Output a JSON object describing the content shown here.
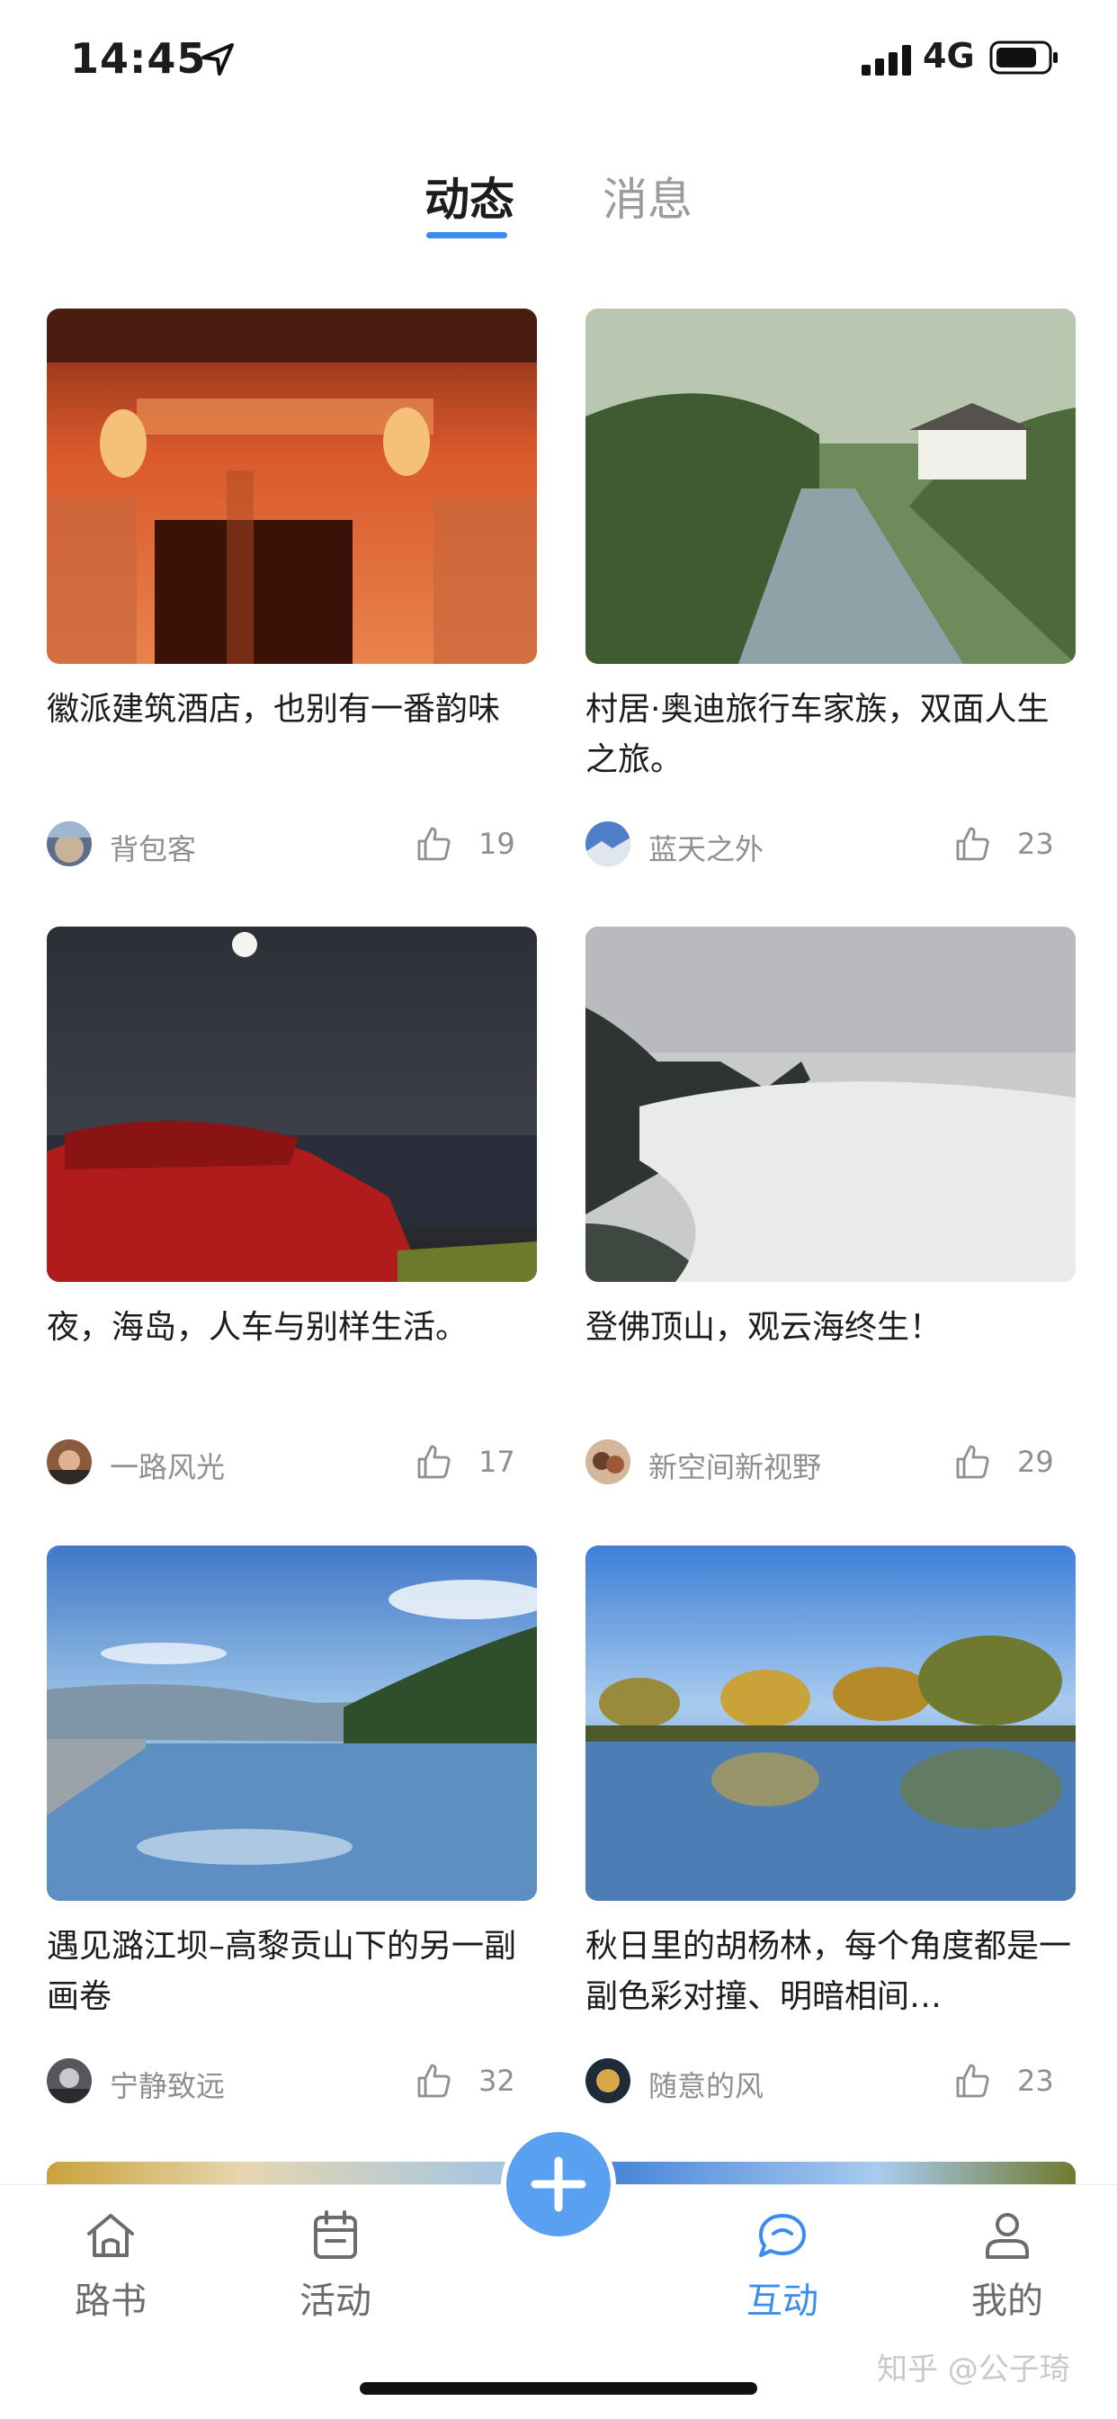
{
  "status_bar": {
    "time": "14:45",
    "network": "4G"
  },
  "tabs": [
    {
      "label": "动态",
      "active": true
    },
    {
      "label": "消息",
      "active": false
    }
  ],
  "cards": [
    {
      "title": "徽派建筑酒店，也别有一番韵味",
      "author": "背包客",
      "likes": "19",
      "image": "hui-style-hotel-gate-photo"
    },
    {
      "title": "村居·奥迪旅行车家族，双面人生之旅。",
      "author": "蓝天之外",
      "likes": "23",
      "image": "village-stream-photo"
    },
    {
      "title": "夜，海岛，人车与别样生活。",
      "author": "一路风光",
      "likes": "17",
      "image": "night-island-car-photo"
    },
    {
      "title": "登佛顶山，观云海终生！",
      "author": "新空间新视野",
      "likes": "29",
      "image": "sea-of-clouds-mountain-photo"
    },
    {
      "title": "遇见潞江坝–高黎贡山下的另一副画卷",
      "author": "宁静致远",
      "likes": "32",
      "image": "infinity-pool-lake-photo"
    },
    {
      "title": "秋日里的胡杨林，每个角度都是一副色彩对撞、明暗相间…",
      "author": "随意的风",
      "likes": "23",
      "image": "populus-lake-reflection-photo"
    }
  ],
  "tab_bar": [
    {
      "label": "路书",
      "icon": "home-icon",
      "active": false
    },
    {
      "label": "活动",
      "icon": "calendar-icon",
      "active": false
    },
    {
      "label": "互动",
      "icon": "chat-bubble-icon",
      "active": true
    },
    {
      "label": "我的",
      "icon": "user-icon",
      "active": false
    }
  ],
  "add_button": {
    "icon": "plus-icon"
  },
  "watermark": "知乎 @公子琦",
  "colors": {
    "accent": "#3b8cf0",
    "add_button": "#5aa0f0",
    "text_primary": "#1c1c1e",
    "text_secondary": "#8e8e93"
  }
}
